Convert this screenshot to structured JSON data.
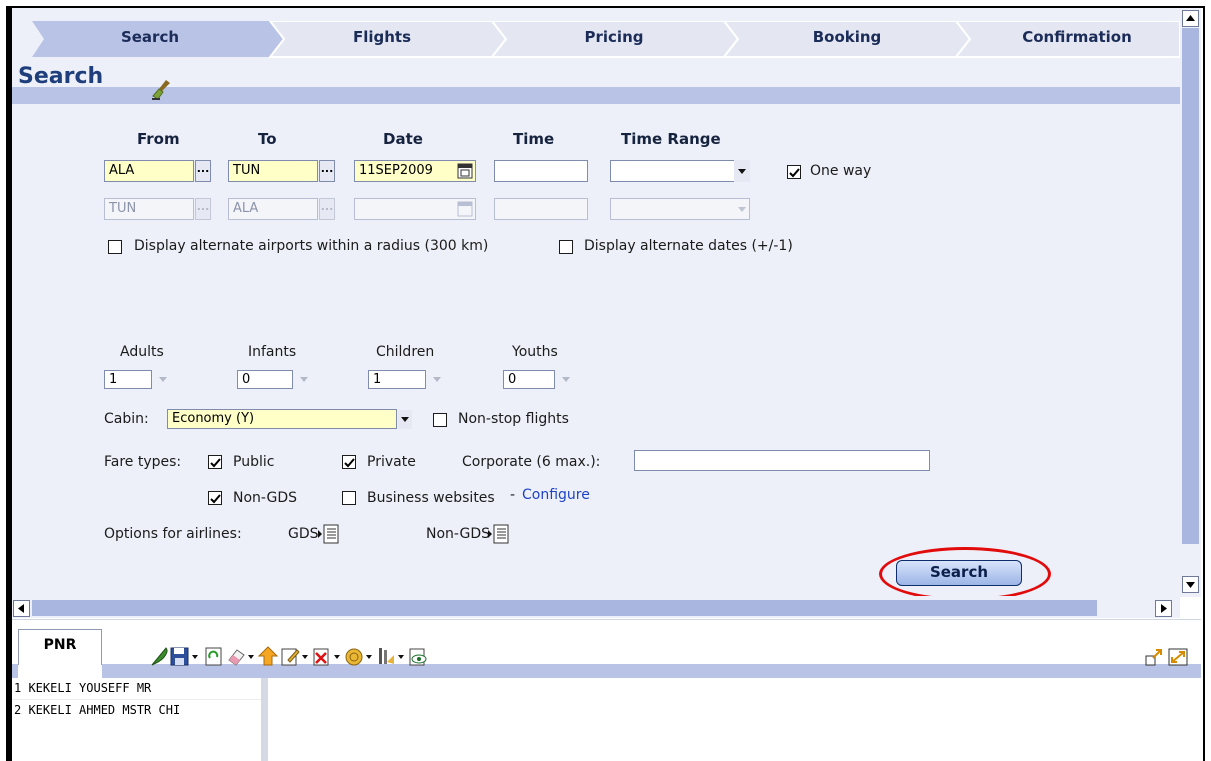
{
  "steps": [
    "Search",
    "Flights",
    "Pricing",
    "Booking",
    "Confirmation"
  ],
  "title": "Search",
  "headers": {
    "from": "From",
    "to": "To",
    "date": "Date",
    "time": "Time",
    "time_range": "Time Range"
  },
  "outbound": {
    "from": "ALA",
    "to": "TUN",
    "date": "11SEP2009",
    "time": "",
    "time_range": ""
  },
  "return": {
    "from": "TUN",
    "to": "ALA",
    "date": "",
    "time": "",
    "time_range": ""
  },
  "one_way": {
    "label": "One way",
    "checked": true
  },
  "alt_airports": {
    "label": "Display alternate airports within a radius (300 km)",
    "checked": false
  },
  "alt_dates": {
    "label": "Display alternate dates (+/-1)",
    "checked": false
  },
  "passengers": [
    {
      "label": "Adults",
      "value": "1"
    },
    {
      "label": "Infants",
      "value": "0"
    },
    {
      "label": "Children",
      "value": "1"
    },
    {
      "label": "Youths",
      "value": "0"
    }
  ],
  "cabin": {
    "label": "Cabin:",
    "value": "Economy (Y)"
  },
  "non_stop": {
    "label": "Non-stop flights",
    "checked": false
  },
  "fare_types": {
    "label": "Fare types:",
    "public": {
      "label": "Public",
      "checked": true
    },
    "private": {
      "label": "Private",
      "checked": true
    },
    "corporate_label": "Corporate (6 max.):",
    "corporate_value": "",
    "non_gds": {
      "label": "Non-GDS",
      "checked": true
    },
    "business": {
      "label": "Business websites",
      "checked": false
    },
    "configure_prefix": "-",
    "configure_link": "Configure"
  },
  "airline_options": {
    "label": "Options for airlines:",
    "gds": "GDS",
    "non_gds": "Non-GDS"
  },
  "search_button": "Search",
  "pnr": {
    "tab": "PNR",
    "lines": [
      "1 KEKELI YOUSEFF MR",
      "2 KEKELI AHMED MSTR CHI"
    ]
  },
  "colors": {
    "accent": "#1f3f7c",
    "panel": "#eef0f9",
    "band": "#b9c3e6",
    "highlight_oval": "#e20b0b",
    "input_yellow": "#ffffc8"
  }
}
